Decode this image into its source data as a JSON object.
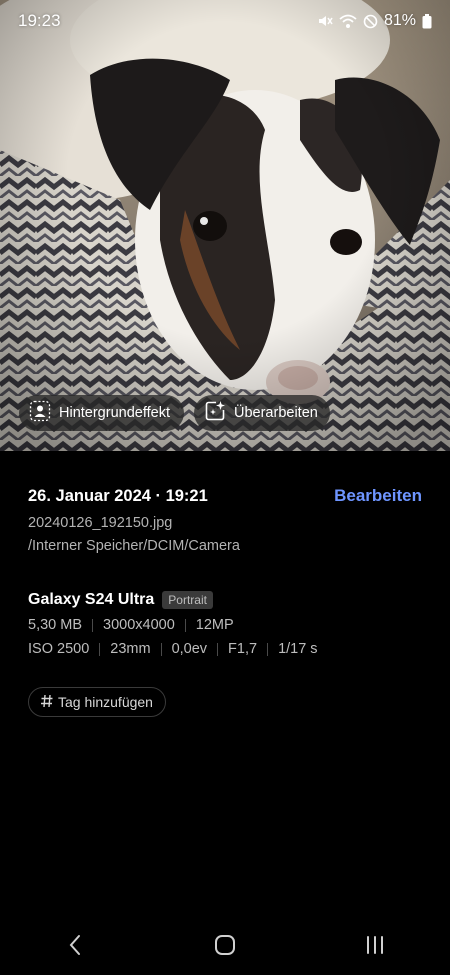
{
  "status_bar": {
    "time": "19:23",
    "battery": "81%",
    "icons": [
      "mute-icon",
      "wifi-icon",
      "do-not-disturb-icon",
      "battery-icon"
    ]
  },
  "photo": {
    "subject": "dog-photo"
  },
  "chips": {
    "background_effect": "Hintergrundeffekt",
    "rework": "Überarbeiten"
  },
  "details": {
    "datetime": "26. Januar 2024 · 19:21",
    "edit_label": "Bearbeiten",
    "filename": "20240126_192150.jpg",
    "path": "/Interner Speicher/DCIM/Camera",
    "device": "Galaxy S24 Ultra",
    "mode_badge": "Portrait",
    "file_info": [
      "5,30 MB",
      "3000x4000",
      "12MP"
    ],
    "exposure_info": [
      "ISO 2500",
      "23mm",
      "0,0ev",
      "F1,7",
      "1/17 s"
    ],
    "add_tag": "Tag hinzufügen"
  },
  "colors": {
    "accent": "#6e95ff",
    "background": "#000000"
  },
  "navigation": {
    "buttons": [
      "back-icon",
      "home-icon",
      "recents-icon"
    ]
  }
}
